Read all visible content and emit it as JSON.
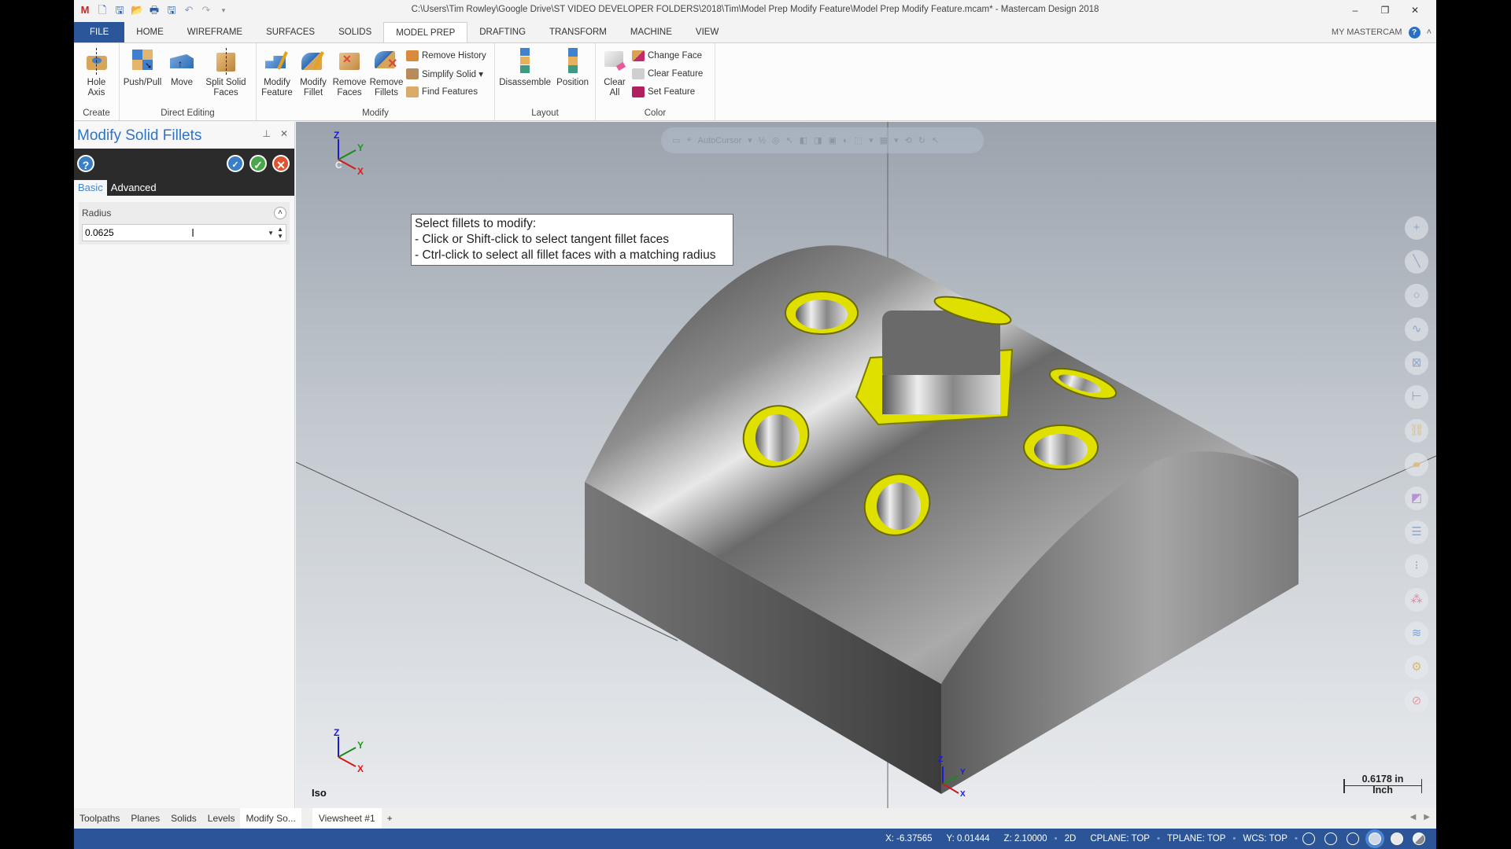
{
  "window": {
    "title": "C:\\Users\\Tim Rowley\\Google Drive\\ST VIDEO DEVELOPER FOLDERS\\2018\\Tim\\Model Prep Modify Feature\\Model Prep Modify Feature.mcam* - Mastercam Design 2018",
    "controls": {
      "minimize": "–",
      "restore": "❐",
      "close": "✕"
    }
  },
  "quick_access": [
    "app-icon",
    "new-icon",
    "save-icon",
    "open-icon",
    "print-icon",
    "save-as-icon",
    "undo-icon",
    "redo-icon",
    "customize-icon"
  ],
  "tabs": [
    {
      "label": "FILE"
    },
    {
      "label": "HOME"
    },
    {
      "label": "WIREFRAME"
    },
    {
      "label": "SURFACES"
    },
    {
      "label": "SOLIDS"
    },
    {
      "label": "MODEL PREP",
      "active": true
    },
    {
      "label": "DRAFTING"
    },
    {
      "label": "TRANSFORM"
    },
    {
      "label": "MACHINE"
    },
    {
      "label": "VIEW"
    }
  ],
  "tabs_right": {
    "my_mastercam": "MY MASTERCAM",
    "help": "?",
    "collapse": "˄"
  },
  "ribbon": {
    "create": {
      "label": "Create",
      "buttons": [
        {
          "label": "Hole\nAxis"
        }
      ]
    },
    "direct_editing": {
      "label": "Direct Editing",
      "buttons": [
        {
          "label": "Push/Pull"
        },
        {
          "label": "Move"
        },
        {
          "label": "Split Solid Faces"
        }
      ]
    },
    "modify": {
      "label": "Modify",
      "buttons": [
        {
          "label": "Modify Feature"
        },
        {
          "label": "Modify Fillet"
        },
        {
          "label": "Remove Faces"
        },
        {
          "label": "Remove Fillets"
        }
      ],
      "small": [
        {
          "label": "Remove History"
        },
        {
          "label": "Simplify Solid ▾"
        },
        {
          "label": "Find Features"
        }
      ]
    },
    "layout": {
      "label": "Layout",
      "buttons": [
        {
          "label": "Disassemble"
        },
        {
          "label": "Position"
        }
      ]
    },
    "color": {
      "label": "Color",
      "buttons": [
        {
          "label": "Clear All"
        }
      ],
      "small": [
        {
          "label": "Change Face"
        },
        {
          "label": "Clear Feature"
        },
        {
          "label": "Set Feature"
        }
      ]
    }
  },
  "panel": {
    "title": "Modify Solid Fillets",
    "pin": "⊥",
    "close": "✕",
    "tabs": [
      {
        "label": "Basic",
        "active": true
      },
      {
        "label": "Advanced"
      }
    ],
    "radius": {
      "label": "Radius",
      "value": "0.0625"
    }
  },
  "viewport": {
    "autocursor_label": "AutoCursor",
    "tooltip": {
      "line1": "Select fillets to modify:",
      "line2": "- Click or Shift-click to select tangent fillet faces",
      "line3": "- Ctrl-click to select all fillet faces with a matching radius"
    },
    "view_name": "Iso",
    "scale": {
      "value": "0.6178 in",
      "unit": "Inch"
    },
    "axis_labels": {
      "x": "X",
      "y": "Y",
      "z": "Z",
      "c": "C"
    },
    "right_tools": [
      "point-icon",
      "line-icon",
      "circle-icon",
      "spline-icon",
      "solid-box-icon",
      "dimension-icon",
      "chain-icon",
      "surface-icon",
      "translate-icon",
      "level-list-icon",
      "level-icon",
      "group-icon",
      "layers-icon",
      "gear-icon",
      "no-entry-icon"
    ]
  },
  "bottom_tabs": [
    {
      "label": "Toolpaths"
    },
    {
      "label": "Planes"
    },
    {
      "label": "Solids"
    },
    {
      "label": "Levels"
    },
    {
      "label": "Modify So...",
      "active": true
    }
  ],
  "viewsheet": {
    "label": "Viewsheet #1",
    "add": "+"
  },
  "status": {
    "x": "X:  -6.37565",
    "y": "Y:  0.01444",
    "z": "Z:  2.10000",
    "mode": "2D",
    "cplane": "CPLANE: TOP",
    "tplane": "TPLANE: TOP",
    "wcs": "WCS: TOP"
  },
  "colors": {
    "accent": "#2b579a",
    "panel_title": "#2f73c3",
    "status_bar": "#2b5597",
    "highlight_fillet": "#e5e600"
  }
}
